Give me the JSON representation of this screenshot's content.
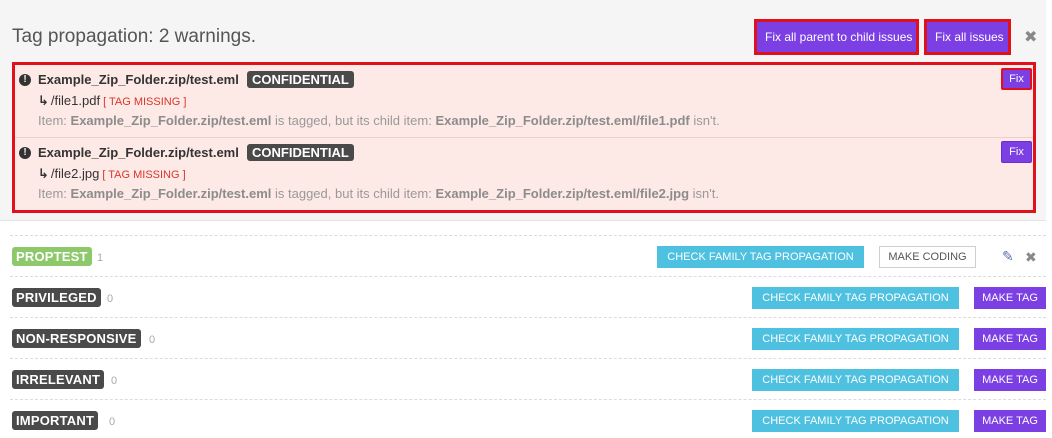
{
  "panel": {
    "title": "Tag propagation: 2 warnings.",
    "fix_parent_label": "Fix all parent to child issues",
    "fix_all_label": "Fix all issues",
    "close_glyph": "✖"
  },
  "issues": [
    {
      "parent": "Example_Zip_Folder.zip/test.eml",
      "tag": "CONFIDENTIAL",
      "child_arrow": "↳",
      "child": "/file1.pdf",
      "missing": "[ TAG MISSING ]",
      "desc_prefix": "Item:",
      "desc_parent": "Example_Zip_Folder.zip/test.eml",
      "desc_mid": "is tagged, but its child item:",
      "desc_child": "Example_Zip_Folder.zip/test.eml/file1.pdf",
      "desc_suffix": "isn't.",
      "fix_label": "Fix"
    },
    {
      "parent": "Example_Zip_Folder.zip/test.eml",
      "tag": "CONFIDENTIAL",
      "child_arrow": "↳",
      "child": "/file2.jpg",
      "missing": "[ TAG MISSING ]",
      "desc_prefix": "Item:",
      "desc_parent": "Example_Zip_Folder.zip/test.eml",
      "desc_mid": "is tagged, but its child item:",
      "desc_child": "Example_Zip_Folder.zip/test.eml/file2.jpg",
      "desc_suffix": "isn't.",
      "fix_label": "Fix"
    }
  ],
  "tags": [
    {
      "name": "PROPTEST",
      "count": "1",
      "color": "#8dc96b",
      "check_label": "CHECK FAMILY TAG PROPAGATION",
      "action_label": "MAKE CODING"
    },
    {
      "name": "PRIVILEGED",
      "count": "0",
      "color": "#4a4a4a",
      "check_label": "CHECK FAMILY TAG PROPAGATION",
      "action_label": "MAKE TAG"
    },
    {
      "name": "NON-RESPONSIVE",
      "count": "0",
      "color": "#4a4a4a",
      "check_label": "CHECK FAMILY TAG PROPAGATION",
      "action_label": "MAKE TAG"
    },
    {
      "name": "IRRELEVANT",
      "count": "0",
      "color": "#4a4a4a",
      "check_label": "CHECK FAMILY TAG PROPAGATION",
      "action_label": "MAKE TAG"
    },
    {
      "name": "IMPORTANT",
      "count": "0",
      "color": "#4a4a4a",
      "check_label": "CHECK FAMILY TAG PROPAGATION",
      "action_label": "MAKE TAG"
    }
  ],
  "icons": {
    "warning": "exclamation-circle-icon",
    "pencil": "pencil-icon",
    "close": "close-icon",
    "pencil_glyph": "✎",
    "warn_glyph": "!"
  }
}
